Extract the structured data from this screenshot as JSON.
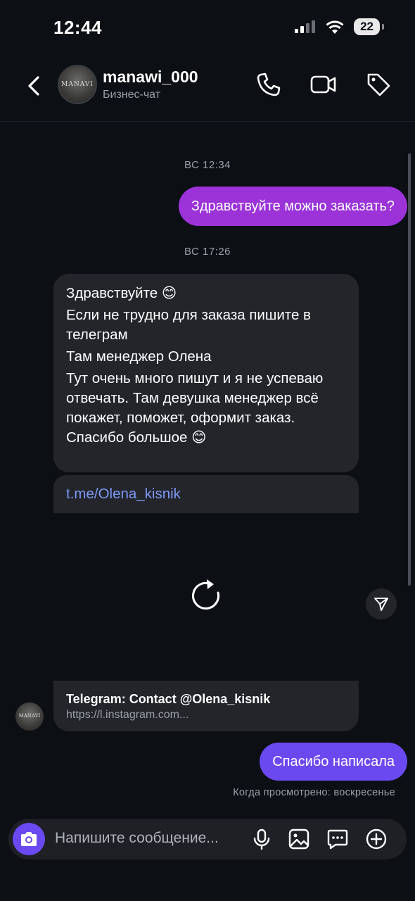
{
  "status_bar": {
    "time": "12:44",
    "battery": "22"
  },
  "header": {
    "name": "manawi_000",
    "subtitle": "Бизнес-чат",
    "avatar_text": "MANAVI"
  },
  "conversation": {
    "timestamp_1": "ВС 12:34",
    "outgoing_1": "Здравствуйте можно заказать?",
    "timestamp_2": "ВС 17:26",
    "incoming_lines": [
      "Здравствуйте 😊",
      "Если не трудно для заказа пишите в телеграм",
      "Там менеджер Олена",
      "Тут очень много пишут и я не успеваю отвечать. Там девушка менеджер всё покажет, поможет, оформит заказ. Спасибо большое 😊"
    ],
    "link_text": "t.me/Olena_kisnik",
    "preview_title": "Telegram: Contact @Olena_kisnik",
    "preview_url": "https://l.instagram.com...",
    "outgoing_2": "Спасибо написала",
    "seen_status": "Когда просмотрено: воскресенье"
  },
  "composer": {
    "placeholder": "Напишите сообщение..."
  },
  "colors": {
    "background": "#0c0f14",
    "outgoing_bubble_1": "#9b33d8",
    "outgoing_bubble_2": "#6a4af0",
    "incoming_bubble": "#23252b",
    "link": "#7d98f5",
    "accent_camera": "#6a4af0"
  },
  "icons": [
    "back-chevron-icon",
    "phone-icon",
    "video-camera-icon",
    "tag-icon",
    "reload-icon",
    "share-icon",
    "camera-icon",
    "microphone-icon",
    "image-icon",
    "sticker-icon",
    "plus-icon"
  ]
}
